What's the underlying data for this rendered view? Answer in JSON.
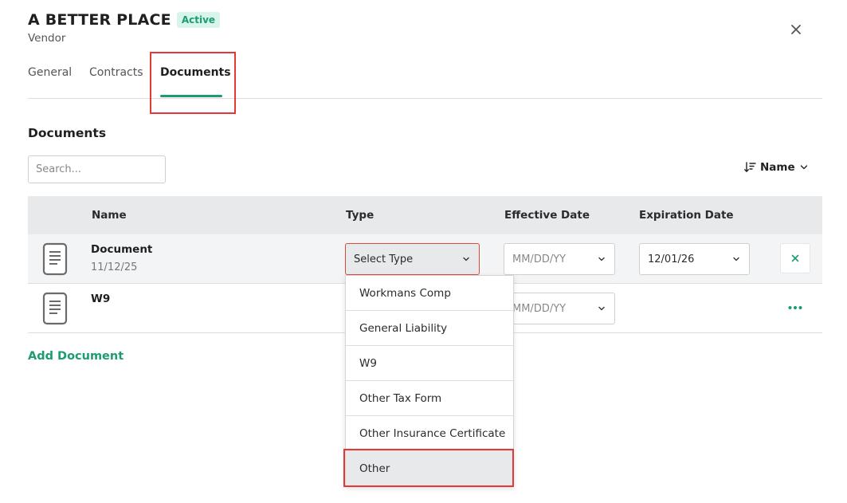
{
  "header": {
    "vendor_name": "A BETTER PLACE",
    "status": "Active",
    "subtitle": "Vendor"
  },
  "tabs": [
    {
      "label": "General",
      "active": false
    },
    {
      "label": "Contracts",
      "active": false
    },
    {
      "label": "Documents",
      "active": true
    }
  ],
  "section": {
    "title": "Documents",
    "search_placeholder": "Search...",
    "sort_label": "Name"
  },
  "table": {
    "columns": [
      "Name",
      "Type",
      "Effective Date",
      "Expiration Date"
    ],
    "rows": [
      {
        "name": "Document",
        "date": "11/12/25",
        "type": "Select Type",
        "effective": "MM/DD/YY",
        "expiration": "12/01/26"
      },
      {
        "name": "W9",
        "date": "",
        "type": "",
        "effective": "MM/DD/YY",
        "expiration": ""
      }
    ]
  },
  "add_document_label": "Add Document",
  "type_dropdown": {
    "options": [
      "Workmans Comp",
      "General Liability",
      "W9",
      "Other Tax Form",
      "Other Insurance Certificate",
      "Other"
    ],
    "highlighted": "Other"
  },
  "colors": {
    "accent": "#1b9c74",
    "highlight_box": "#e53935",
    "header_bg": "#e8e9eb"
  },
  "icons": {
    "close": "close-icon",
    "sort": "sort-icon",
    "document": "document-icon",
    "remove": "close-icon",
    "more": "ellipsis-icon"
  }
}
